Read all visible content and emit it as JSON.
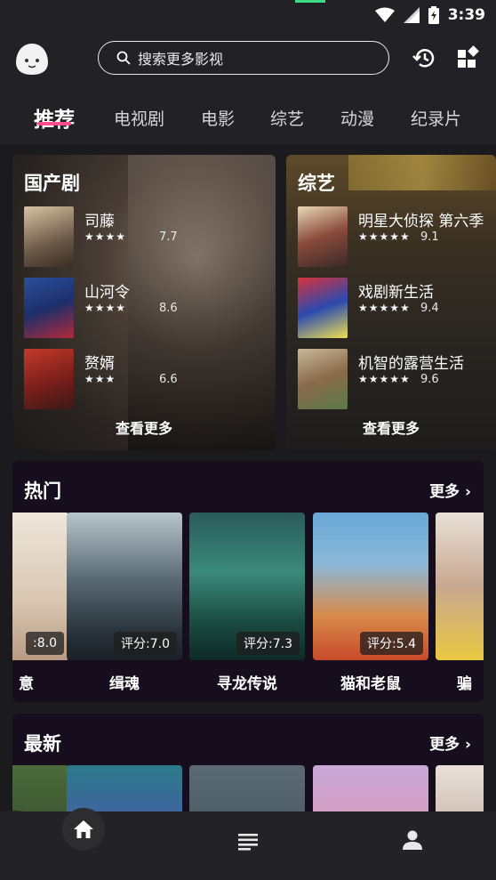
{
  "status_bar": {
    "time": "3:39"
  },
  "header": {
    "search_placeholder": "搜索更多影视",
    "tabs": [
      "推荐",
      "电视剧",
      "电影",
      "综艺",
      "动漫",
      "纪录片"
    ],
    "active_tab": "推荐"
  },
  "categories": [
    {
      "title": "国产剧",
      "items": [
        {
          "name": "司藤",
          "stars": "★★★★",
          "score": "7.7"
        },
        {
          "name": "山河令",
          "stars": "★★★★",
          "score": "8.6"
        },
        {
          "name": "赘婿",
          "stars": "★★★",
          "score": "6.6"
        }
      ],
      "more_label": "查看更多"
    },
    {
      "title": "综艺",
      "items": [
        {
          "name": "明星大侦探 第六季",
          "stars": "★★★★★",
          "score": "9.1"
        },
        {
          "name": "戏剧新生活",
          "stars": "★★★★★",
          "score": "9.4"
        },
        {
          "name": "机智的露营生活",
          "stars": "★★★★★",
          "score": "9.6"
        }
      ],
      "more_label": "查看更多"
    }
  ],
  "hot": {
    "title": "热门",
    "more_label": "更多",
    "items": [
      {
        "name": "意",
        "score": "8.0",
        "score_label": ":8.0"
      },
      {
        "name": "缉魂",
        "score": "7.0",
        "score_label": "评分:7.0"
      },
      {
        "name": "寻龙传说",
        "score": "7.3",
        "score_label": "评分:7.3"
      },
      {
        "name": "猫和老鼠",
        "score": "5.4",
        "score_label": "评分:5.4"
      },
      {
        "name": "骗",
        "score": "",
        "score_label": ""
      }
    ]
  },
  "latest": {
    "title": "最新",
    "more_label": "更多"
  },
  "colors": {
    "accent": "#ff4d8d",
    "background": "#1b1b1f",
    "section_bg": "#160e1d"
  },
  "nav": {
    "items": [
      "home-icon",
      "list-icon",
      "person-icon"
    ]
  }
}
